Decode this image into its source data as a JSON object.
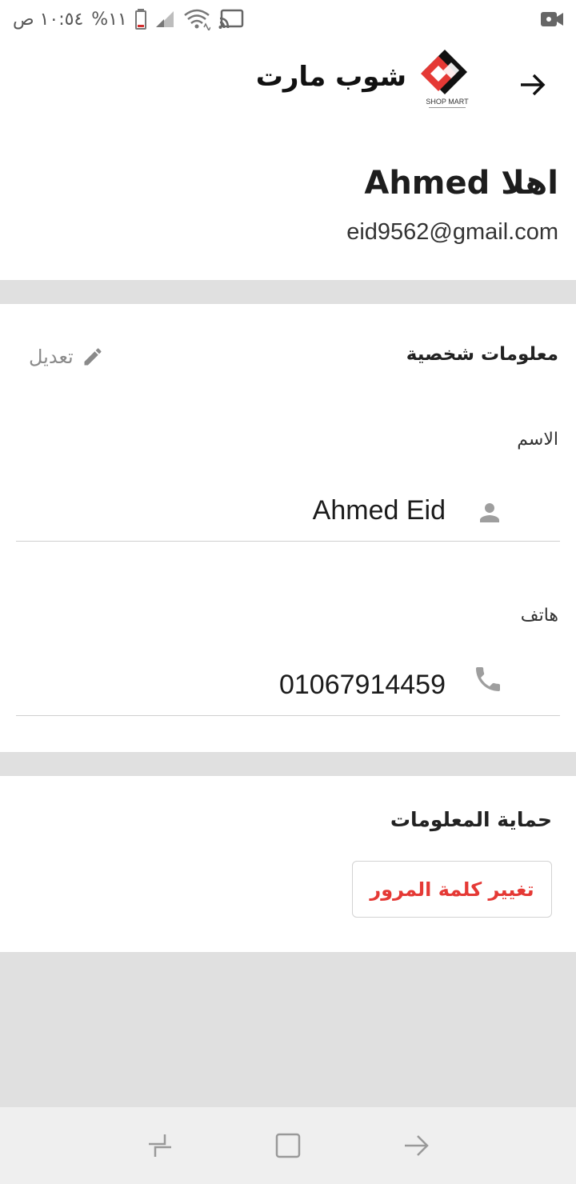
{
  "status_bar": {
    "time": "١٠:٥٤ ص",
    "battery": "%١١"
  },
  "app_bar": {
    "title": "شوب مارت",
    "logo_text": "SHOP MART"
  },
  "profile": {
    "greeting": "اهلا Ahmed",
    "email": "eid9562@gmail.com"
  },
  "personal_info": {
    "title": "معلومات شخصية",
    "edit_label": "تعديل",
    "name_label": "الاسم",
    "name_value": "Ahmed Eid",
    "phone_label": "هاتف",
    "phone_value": "01067914459"
  },
  "security": {
    "title": "حماية المعلومات",
    "change_password_label": "تغيير كلمة المرور"
  },
  "icons": {
    "back": "arrow-right-icon",
    "edit": "pencil-icon",
    "name": "person-icon",
    "phone": "phone-icon",
    "camera": "video-camera-icon",
    "cast": "cast-icon",
    "wifi": "wifi-icon",
    "signal": "signal-icon",
    "battery": "battery-icon",
    "nav_recent": "recents-icon",
    "nav_home": "home-icon",
    "nav_back": "back-arrow-icon"
  },
  "colors": {
    "accent_red": "#e53935",
    "divider": "#e0e0e0",
    "nav_bg": "#efefef"
  }
}
